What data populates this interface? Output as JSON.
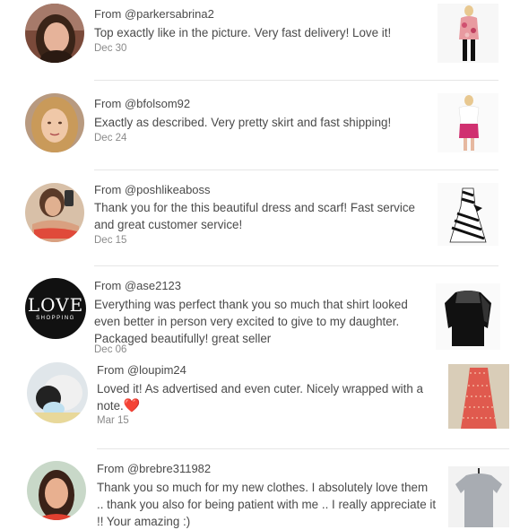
{
  "reviews": [
    {
      "from": "From @parkersabrina2",
      "message": "Top exactly like in the picture. Very fast delivery! Love it!",
      "date": "Dec 30",
      "avatar": "profile-photo-woman-dark-hair",
      "item": "floral-top-outfit-photo"
    },
    {
      "from": "From @bfolsom92",
      "message": "Exactly as described. Very pretty skirt and fast shipping!",
      "date": "Dec 24",
      "avatar": "profile-photo-woman-blonde",
      "item": "pink-skirt-outfit-photo"
    },
    {
      "from": "From @poshlikeaboss",
      "message": "Thank you for the this beautiful dress and scarf! Fast service and great customer service!",
      "date": "Dec 15",
      "avatar": "profile-photo-woman-selfie",
      "item": "striped-dress-photo"
    },
    {
      "from": "From @ase2123",
      "message": "Everything was perfect thank you so much that shirt looked even better in person very excited to give to my daughter. Packaged beautifully! great seller",
      "date": "Dec 06",
      "avatar": "love-shopping-logo",
      "avatar_text": "LOVE",
      "avatar_subtext": "SHOPPING",
      "item": "black-lace-top-photo"
    },
    {
      "from": "From @loupim24",
      "message": "Loved it! As advertised and even cuter. Nicely wrapped with a note.",
      "emoji": "❤️",
      "date": "Mar 15",
      "avatar": "profile-photo-child-hat",
      "item": "coral-dress-photo"
    },
    {
      "from": "From @brebre311982",
      "message": "Thank you so much for my new clothes. I absolutely love them .. thank you also for being patient with me .. I really appreciate it !! Your amazing :)",
      "date": "",
      "avatar": "profile-photo-woman-red",
      "item": "gray-tshirt-photo"
    }
  ]
}
